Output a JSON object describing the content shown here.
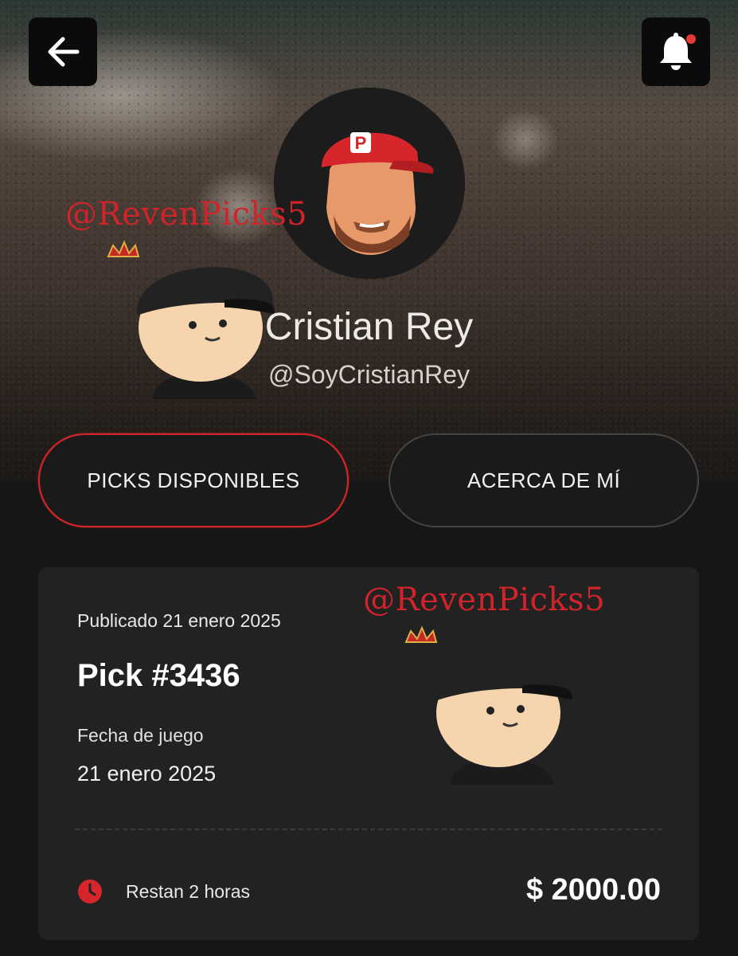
{
  "header": {
    "back_icon": "arrow-left-icon",
    "notification_icon": "bell-icon",
    "notification_dot_color": "#e53935"
  },
  "profile": {
    "name": "Cristian Rey",
    "handle": "@SoyCristianRey",
    "avatar_logo_letter": "P"
  },
  "tabs": [
    {
      "label": "PICKS DISPONIBLES",
      "active": true
    },
    {
      "label": "ACERCA DE MÍ",
      "active": false
    }
  ],
  "pick_card": {
    "published": "Publicado 21 enero 2025",
    "title": "Pick #3436",
    "game_date_label": "Fecha de juego",
    "game_date": "21 enero 2025",
    "clock_icon": "clock-icon",
    "remaining": "Restan 2 horas",
    "price": "$ 2000.00"
  },
  "watermarks": [
    {
      "text": "@RevenPicks5"
    },
    {
      "text": "@RevenPicks5"
    }
  ],
  "colors": {
    "accent_red": "#d7262b",
    "background": "#161616",
    "card": "#222222"
  }
}
